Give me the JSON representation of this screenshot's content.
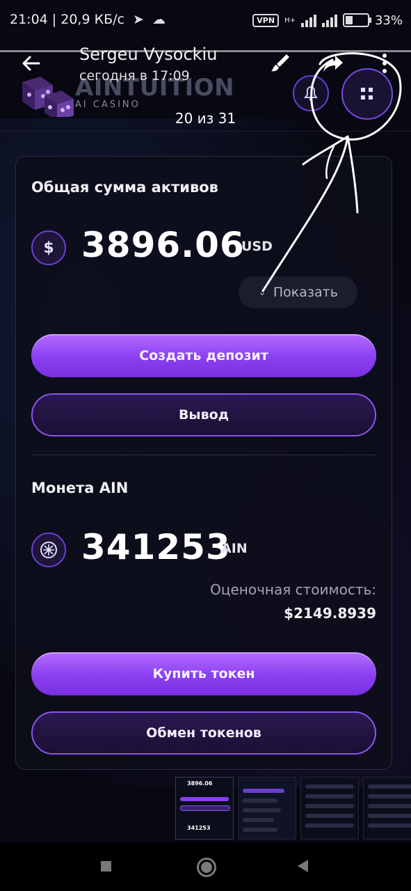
{
  "status_bar": {
    "time_speed": "21:04 | 20,9 КБ/с",
    "vpn": "VPN",
    "network": "H+",
    "battery": "33%"
  },
  "viewer": {
    "sender": "Sergeu Vysockiu",
    "date": "сегодня в 17:09",
    "counter": "20 из 31"
  },
  "header": {
    "logo_text": "AINTUITION",
    "logo_sub": "AI CASINO"
  },
  "assets": {
    "title": "Общая сумма активов",
    "amount": "3896.06",
    "currency": "USD",
    "show_label": "Показать",
    "deposit_label": "Создать депозит",
    "withdraw_label": "Вывод"
  },
  "coin": {
    "title": "Монета AIN",
    "amount": "341253",
    "unit": "AIN",
    "est_label": "Оценочная стоимость:",
    "est_value": "$2149.8939",
    "buy_label": "Купить токен",
    "exchange_label": "Обмен токенов"
  },
  "thumbs": {
    "t1_amount": "3896.06",
    "t1_coin": "341253"
  },
  "icons": {
    "back": "arrow-left-icon",
    "brush": "brush-icon",
    "share": "share-icon",
    "more": "more-vertical-icon",
    "bell": "bell-icon",
    "grid": "grid-icon",
    "dollar": "dollar-coin-icon",
    "ain": "ain-coin-icon"
  },
  "colors": {
    "accent": "#8a3ff0",
    "background": "#070812",
    "card_border": "#2b2d40"
  }
}
